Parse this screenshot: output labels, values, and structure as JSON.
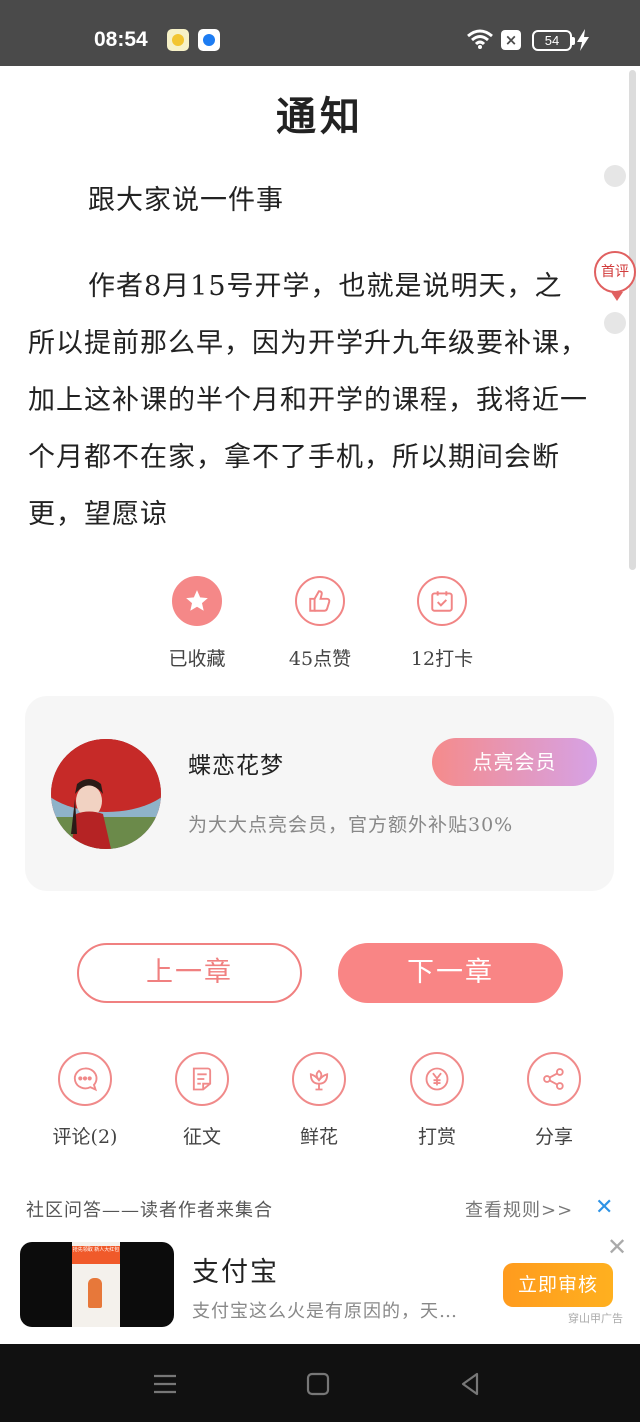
{
  "status_bar": {
    "time": "08:54",
    "battery": "54"
  },
  "article": {
    "title": "通知",
    "paragraphs": [
      "跟大家说一件事",
      "作者8月15号开学，也就是说明天，之所以提前那么早，因为开学升九年级要补课，加上这补课的半个月和开学的课程，我将近一个月都不在家，拿不了手机，所以期间会断更，望愿谅"
    ],
    "comment_bubble": "首评"
  },
  "actions": [
    {
      "label": "已收藏",
      "icon": "star-icon"
    },
    {
      "label": "45点赞",
      "icon": "thumb-up-icon"
    },
    {
      "label": "12打卡",
      "icon": "calendar-check-icon"
    }
  ],
  "author_card": {
    "name": "蝶恋花梦",
    "subtitle": "为大大点亮会员，官方额外补贴30%",
    "vip_button": "点亮会员"
  },
  "chapter_nav": {
    "prev": "上一章",
    "next": "下一章"
  },
  "tools": [
    {
      "label": "评论(2)",
      "icon": "comment-icon"
    },
    {
      "label": "征文",
      "icon": "essay-icon"
    },
    {
      "label": "鲜花",
      "icon": "flower-icon"
    },
    {
      "label": "打赏",
      "icon": "yen-icon"
    },
    {
      "label": "分享",
      "icon": "share-icon"
    }
  ],
  "community": {
    "title": "社区问答——读者作者来集合",
    "rules": "查看规则>>"
  },
  "ad": {
    "title": "支付宝",
    "description": "支付宝这么火是有原因的，天…",
    "button": "立即审核",
    "tag": "穿山甲广告",
    "poster_text": "抢先领取 新人大红包"
  },
  "colors": {
    "accent": "#f58888",
    "link": "#2e93e6",
    "ad_button": "#ffa31f"
  }
}
